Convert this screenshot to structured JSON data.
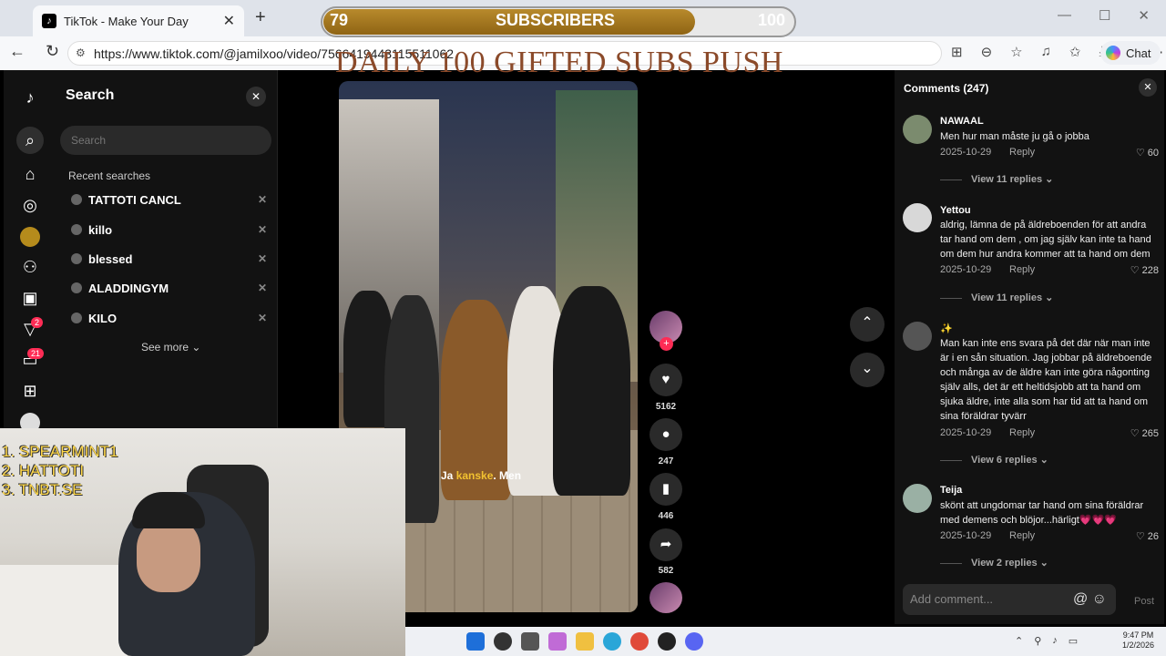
{
  "browser": {
    "tab_title": "TikTok - Make Your Day",
    "tab_close": "✕",
    "new_tab": "+",
    "url": "https://www.tiktok.com/@jamilxoo/video/7566419443115511062",
    "chat_label": "Chat"
  },
  "overlay": {
    "sub_current": "79",
    "sub_label": "SUBSCRIBERS",
    "sub_goal": "100",
    "sub_progress": 0.79,
    "push_text": "DAILY 100 GIFTED SUBS PUSH"
  },
  "sidebar": {
    "inbox_badge": "2",
    "activity_badge": "21"
  },
  "search": {
    "title": "Search",
    "placeholder": "Search",
    "recent_heading": "Recent searches",
    "recent": [
      "TATTOTI CANCL",
      "killo",
      "blessed",
      "ALADDINGYM",
      "KILO"
    ],
    "see_more": "See more ⌄"
  },
  "video": {
    "caption_plain1": "Ja ",
    "caption_highlight": "kanske",
    "caption_plain2": ". Men"
  },
  "actions": {
    "likes": "5162",
    "comments": "247",
    "saves": "446",
    "shares": "582"
  },
  "comments": {
    "title": "Comments (247)",
    "items": [
      {
        "user": "NAWAAL",
        "text": "Men hur man måste ju gå o jobba",
        "date": "2025-10-29",
        "reply": "Reply",
        "likes": "60",
        "view": "View 11 replies ⌄"
      },
      {
        "user": "Yettou",
        "text": "aldrig, lämna de på äldreboenden för att andra tar hand om dem , om jag själv kan inte ta hand om dem hur andra kommer att ta hand om dem",
        "date": "2025-10-29",
        "reply": "Reply",
        "likes": "228",
        "view": "View 11 replies ⌄"
      },
      {
        "user": "✨",
        "text": "Man kan inte ens svara på det där när man inte är i en sån situation. Jag jobbar på äldreboende och många av de äldre kan inte göra någonting själv alls, det är ett heltidsjobb att ta hand om sjuka äldre, inte alla som har tid att ta hand om sina föräldrar tyvärr",
        "date": "2025-10-29",
        "reply": "Reply",
        "likes": "265",
        "view": "View 6 replies ⌄"
      },
      {
        "user": "Teija",
        "text": "skönt att ungdomar tar hand om sina föräldrar med demens och blöjor...härligt💗💗💗",
        "date": "2025-10-29",
        "reply": "Reply",
        "likes": "26",
        "view": "View 2 replies ⌄"
      }
    ],
    "add_placeholder": "Add comment...",
    "post": "Post"
  },
  "leaderboard": [
    "1.  SPEARMINT1",
    "2.   HATTOTI",
    "3.  TNBT.SE"
  ],
  "taskbar": {
    "time": "9:47 PM",
    "date": "1/2/2026"
  }
}
